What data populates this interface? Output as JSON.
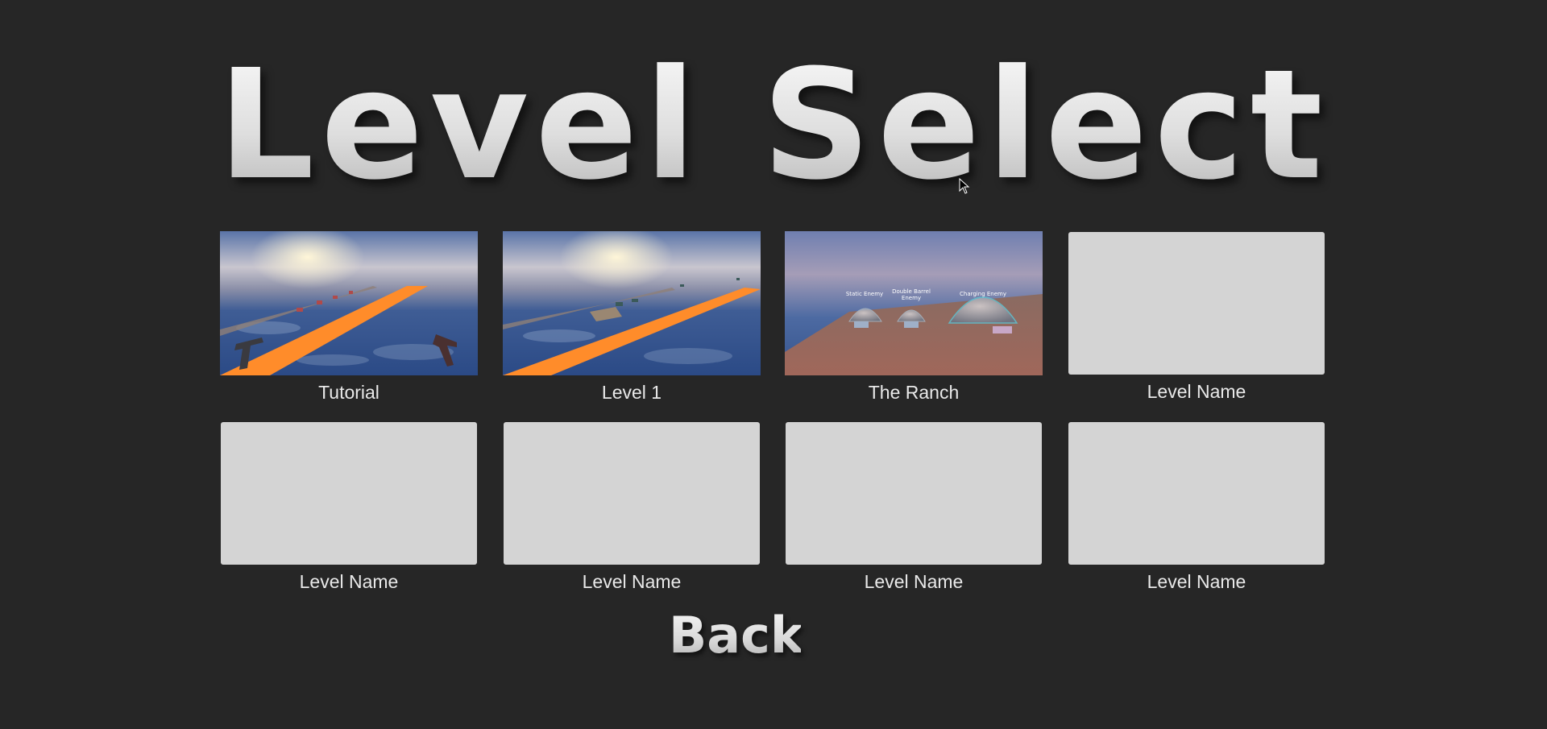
{
  "screen": {
    "title": "Level Select",
    "back_label": "Back"
  },
  "levels": [
    {
      "label": "Tutorial",
      "thumbnail": "tutorial-preview"
    },
    {
      "label": "Level 1",
      "thumbnail": "level1-preview"
    },
    {
      "label": "The Ranch",
      "thumbnail": "ranch-preview",
      "dome_labels": [
        "Static Enemy",
        "Double Barrel\nEnemy",
        "Charging Enemy"
      ]
    },
    {
      "label": "Level Name",
      "thumbnail": "empty"
    },
    {
      "label": "Level Name",
      "thumbnail": "empty"
    },
    {
      "label": "Level Name",
      "thumbnail": "empty"
    },
    {
      "label": "Level Name",
      "thumbnail": "empty"
    },
    {
      "label": "Level Name",
      "thumbnail": "empty"
    }
  ],
  "colors": {
    "background": "#262626",
    "placeholder": "#d4d4d4",
    "runway": "#ff8c2a",
    "label": "#e9e9e9"
  }
}
